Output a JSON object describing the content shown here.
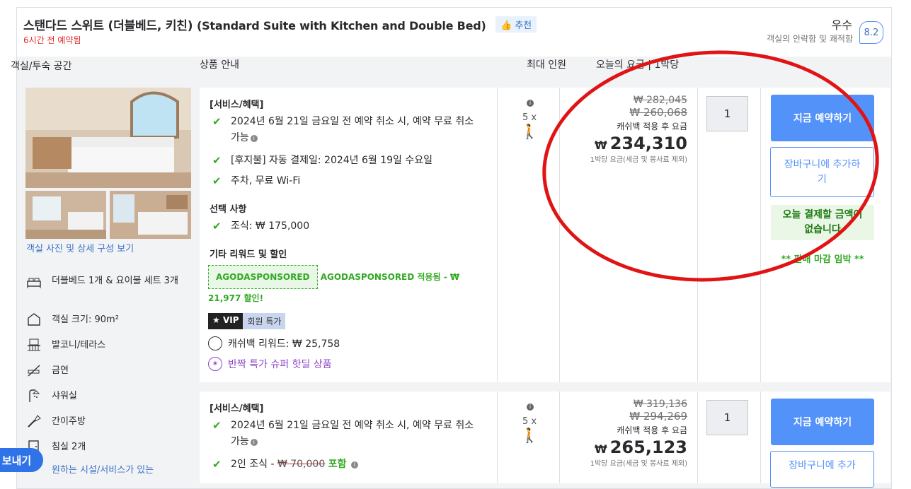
{
  "room": {
    "title_ko": "스탠다드 스위트 (더블베드, 키친)",
    "title_en": "(Standard Suite with Kitchen and Double Bed)",
    "recommend": "추천",
    "booked_text": "6시간 전 예약됨",
    "rating_word": "우수",
    "rating_sub": "객실의 안락함 및 쾌적함",
    "rating_score": "8.2"
  },
  "columns": {
    "room_space": "객실/투숙 공간",
    "product": "상품 안내",
    "max_occupancy": "최대 인원",
    "price_today": "오늘의 요금 | 1박당"
  },
  "photo_link": "객실 사진 및 상세 구성 보기",
  "features": [
    {
      "icon": "bed-icon",
      "label": "더블베드 1개 & 요이불 세트 3개"
    },
    {
      "icon": "room-size-icon",
      "label": "객실 크기: 90m²"
    },
    {
      "icon": "balcony-icon",
      "label": "발코니/테라스"
    },
    {
      "icon": "no-smoking-icon",
      "label": "금연"
    },
    {
      "icon": "shower-icon",
      "label": "샤워실"
    },
    {
      "icon": "kitchenette-icon",
      "label": "간이주방"
    },
    {
      "icon": "bedroom-icon",
      "label": "침실 2개"
    },
    {
      "icon": "facility-icon",
      "label": "원하는 시설/서비스가 있는"
    }
  ],
  "offer1": {
    "benefits_title": "[서비스/혜택]",
    "benefit1": "2024년 6월 21일 금요일 전 예약 취소 시, 예약 무료 취소 가능",
    "benefit2": "[후지불] 자동 결제일: 2024년 6월 19일 수요일",
    "benefit3": "주차, 무료 Wi-Fi",
    "options_title": "선택 사항",
    "option1": "조식: ₩ 175,000",
    "rewards_title": "기타 리워드 및 할인",
    "agoda_badge": "AGODASPONSORED",
    "agoda_text": "AGODASPONSORED 적용됨 - ₩ 21,977 할인!",
    "vip_a": "VIP",
    "vip_b": "회원 특가",
    "cashback": "캐쉬백 리워드: ₩ 25,758",
    "super_deal": "반짝 특가 슈퍼 핫딜 상품",
    "occupancy": "5 x",
    "price_orig1": "₩ 282,045",
    "price_orig2": "₩ 260,068",
    "cash_label": "캐쉬백 적용 후 요금",
    "currency": "₩",
    "price_final": "234,310",
    "per_night": "1박당 요금(세금 및 봉사료 제외)",
    "qty": "1",
    "book_label": "지금 예약하기",
    "cart_label": "장바구니에 추가하기",
    "no_pay": "오늘 결제할 금액이 없습니다",
    "closing": "** 판매 마감 임박 **"
  },
  "offer2": {
    "benefits_title": "[서비스/혜택]",
    "benefit1": "2024년 6월 21일 금요일 전 예약 취소 시, 예약 무료 취소 가능",
    "benefit2_prefix": "2인 조식 - ",
    "benefit2_strike": "₩ 70,000",
    "benefit2_included": "포함",
    "occupancy": "5 x",
    "price_orig1": "₩ 319,136",
    "price_orig2": "₩ 294,269",
    "cash_label": "캐쉬백 적용 후 요금",
    "currency": "₩",
    "price_final": "265,123",
    "per_night": "1박당 요금(세금 및 봉사료 제외)",
    "qty": "1",
    "book_label": "지금 예약하기",
    "cart_label": "장바구니에 추가"
  },
  "send_button": "보내기",
  "colors": {
    "accent": "#5392f9",
    "green": "#32a923",
    "red": "#e12d2d"
  }
}
